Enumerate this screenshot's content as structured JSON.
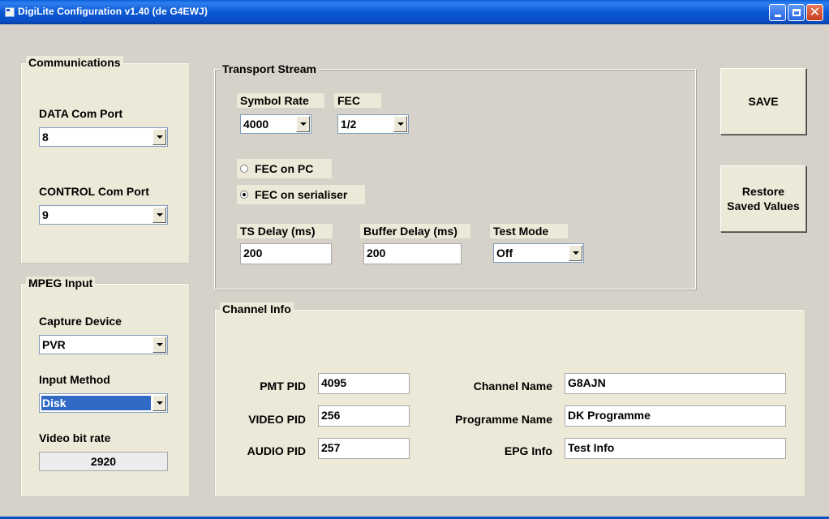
{
  "window": {
    "title": "DigiLite Configuration v1.40    (de G4EWJ)",
    "icon": "app-icon"
  },
  "communications": {
    "title": "Communications",
    "data_port_label": "DATA Com Port",
    "data_port_value": "8",
    "control_port_label": "CONTROL Com Port",
    "control_port_value": "9"
  },
  "mpeg_input": {
    "title": "MPEG Input",
    "capture_label": "Capture Device",
    "capture_value": "PVR",
    "input_method_label": "Input Method",
    "input_method_value": "Disk",
    "bitrate_label": "Video bit rate",
    "bitrate_value": "2920"
  },
  "transport_stream": {
    "title": "Transport Stream",
    "symbol_rate_label": "Symbol Rate",
    "symbol_rate_value": "4000",
    "fec_label": "FEC",
    "fec_value": "1/2",
    "fec_on_pc_label": "FEC on PC",
    "fec_on_pc_checked": false,
    "fec_on_serialiser_label": "FEC on serialiser",
    "fec_on_serialiser_checked": true,
    "ts_delay_label": "TS Delay (ms)",
    "ts_delay_value": "200",
    "buffer_delay_label": "Buffer Delay (ms)",
    "buffer_delay_value": "200",
    "test_mode_label": "Test Mode",
    "test_mode_value": "Off"
  },
  "channel_info": {
    "title": "Channel Info",
    "pmt_pid_label": "PMT PID",
    "pmt_pid_value": "4095",
    "video_pid_label": "VIDEO PID",
    "video_pid_value": "256",
    "audio_pid_label": "AUDIO PID",
    "audio_pid_value": "257",
    "channel_name_label": "Channel Name",
    "channel_name_value": "G8AJN",
    "programme_name_label": "Programme Name",
    "programme_name_value": "DK Programme",
    "epg_info_label": "EPG Info",
    "epg_info_value": "Test Info"
  },
  "actions": {
    "save_label": "SAVE",
    "restore_label": "Restore\nSaved Values"
  },
  "colors": {
    "titlebar": "#0a5ed8",
    "selection": "#316ac5",
    "face": "#ece9d8",
    "background": "#d6d2c9"
  }
}
